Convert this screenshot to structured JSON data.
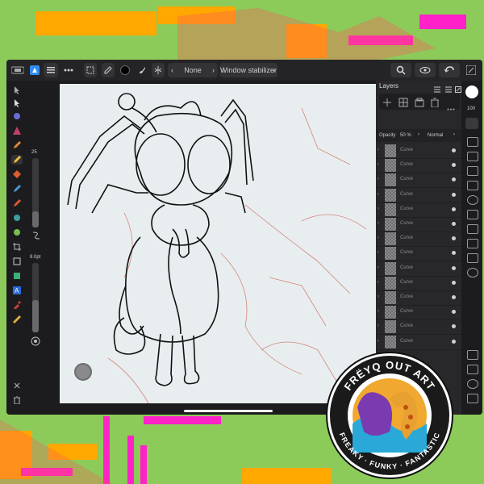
{
  "toolbar": {
    "brush_preset": "None",
    "stabilizer": "Window stabilizer",
    "prev_arrow": "‹",
    "next_arrow": "›"
  },
  "brush_panel": {
    "size_value": "25",
    "spacing_value": "8.0pt"
  },
  "layers_panel": {
    "title": "Layers",
    "opacity_label": "Opacity",
    "opacity_value": "50 %",
    "blend_mode": "Normal",
    "layer_name": "Curve",
    "layers": [
      "Curve",
      "Curve",
      "Curve",
      "Curve",
      "Curve",
      "Curve",
      "Curve",
      "Curve",
      "Curve",
      "Curve",
      "Curve",
      "Curve",
      "Curve",
      "Curve"
    ]
  },
  "studio_bar": {
    "label_100": "100"
  },
  "badge": {
    "top_text": "FRËYQ OUT ART",
    "bottom_text": "FREAKY · FUNKY · FANTASTIC"
  },
  "colors": {
    "app_bg": "#1c1c1e",
    "accent_blue": "#2f8cf0",
    "background_green": "#8ccb5a",
    "magenta": "#ff22c8",
    "orange": "#ffa800"
  },
  "icons": {
    "app": "affinity-designer-icon",
    "menu": "hamburger-icon",
    "more": "ellipsis-icon",
    "pen": "pencil-icon",
    "add_layer": "add-layer-icon",
    "delete_layer": "trash-icon"
  }
}
